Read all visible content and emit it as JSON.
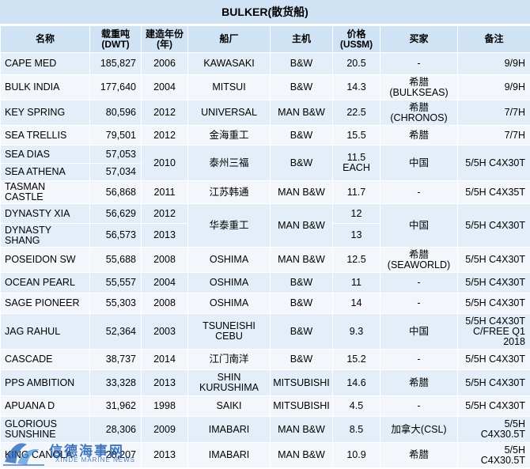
{
  "title": "BULKER(散货船)",
  "headers": {
    "name": "名称",
    "dwt_line1": "载重吨",
    "dwt_line2": "(DWT)",
    "year_line1": "建造年份",
    "year_line2": "(年)",
    "yard": "船厂",
    "engine": "主机",
    "price_line1": "价格",
    "price_line2": "(US$M)",
    "buyer": "买家",
    "note": "备注"
  },
  "rows": {
    "r0": {
      "name": "CAPE MED",
      "dwt": "185,827",
      "year": "2006",
      "yard": "KAWASAKI",
      "engine": "B&W",
      "price": "20.5",
      "buyer": "-",
      "note": "9/9H"
    },
    "r1": {
      "name": "BULK INDIA",
      "dwt": "177,640",
      "year": "2004",
      "yard": "MITSUI",
      "engine": "B&W",
      "price": "14.3",
      "buyer_line1": "希腊",
      "buyer_line2": "(BULKSEAS)",
      "note": "9/9H"
    },
    "r2": {
      "name": "KEY SPRING",
      "dwt": "80,596",
      "year": "2012",
      "yard": "UNIVERSAL",
      "engine": "MAN B&W",
      "price": "22.5",
      "buyer_line1": "希腊",
      "buyer_line2": "(CHRONOS)",
      "note": "7/7H"
    },
    "r3": {
      "name": "SEA TRELLIS",
      "dwt": "79,501",
      "year": "2012",
      "yard": "金海重工",
      "engine": "B&W",
      "price": "15.5",
      "buyer": "希腊",
      "note": "7/7H"
    },
    "r4": {
      "name": "SEA DIAS",
      "dwt": "57,053",
      "year": "2010",
      "yard": "泰州三福",
      "engine": "B&W",
      "price_line1": "11.5",
      "price_line2": "EACH",
      "buyer": "中国",
      "note": "5/5H C4X30T"
    },
    "r5": {
      "name": "SEA ATHENA",
      "dwt": "57,034"
    },
    "r6": {
      "name_line1": "TASMAN",
      "name_line2": "CASTLE",
      "dwt": "56,868",
      "year": "2011",
      "yard": "江苏韩通",
      "engine": "MAN B&W",
      "price": "11.7",
      "buyer": "-",
      "note": "5/5H C4X35T"
    },
    "r7": {
      "name": "DYNASTY XIA",
      "dwt": "56,629",
      "year": "2012",
      "yard": "华泰重工",
      "engine": "MAN B&W",
      "price": "12",
      "buyer": "中国",
      "note": "5/5H C4X30T"
    },
    "r8": {
      "name_line1": "DYNASTY",
      "name_line2": "SHANG",
      "dwt": "56,573",
      "year": "2013",
      "price": "13"
    },
    "r9": {
      "name": "POSEIDON SW",
      "dwt": "55,688",
      "year": "2008",
      "yard": "OSHIMA",
      "engine": "MAN B&W",
      "price": "12.5",
      "buyer_line1": "希腊",
      "buyer_line2": "(SEAWORLD)",
      "note": "5/5H C4X30T"
    },
    "r10": {
      "name": "OCEAN PEARL",
      "dwt": "55,557",
      "year": "2004",
      "yard": "OSHIMA",
      "engine": "B&W",
      "price": "11",
      "buyer": "-",
      "note": "5/5H C4X30T"
    },
    "r11": {
      "name": "SAGE PIONEER",
      "dwt": "55,303",
      "year": "2008",
      "yard": "OSHIMA",
      "engine": "B&W",
      "price": "14",
      "buyer": "-",
      "note": "5/5H C4X30T"
    },
    "r12": {
      "name": "JAG RAHUL",
      "dwt": "52,364",
      "year": "2003",
      "yard_line1": "TSUNEISHI",
      "yard_line2": "CEBU",
      "engine": "B&W",
      "price": "9.3",
      "buyer": "中国",
      "note_line1": "5/5H C4X30T",
      "note_line2": "C/FREE Q1",
      "note_line3": "2018"
    },
    "r13": {
      "name": "CASCADE",
      "dwt": "38,737",
      "year": "2014",
      "yard": "江门南洋",
      "engine": "B&W",
      "price": "15.2",
      "buyer": "-",
      "note": "5/5H C4X30T"
    },
    "r14": {
      "name": "PPS AMBITION",
      "dwt": "33,328",
      "year": "2013",
      "yard_line1": "SHIN",
      "yard_line2": "KURUSHIMA",
      "engine": "MITSUBISHI",
      "price": "14.6",
      "buyer": "希腊",
      "note": "5/5H C4X30T"
    },
    "r15": {
      "name": "APUANA D",
      "dwt": "31,962",
      "year": "1998",
      "yard": "SAIKI",
      "engine": "MITSUBISHI",
      "price": "4.5",
      "buyer": "-",
      "note": "5/5H C4X30T"
    },
    "r16": {
      "name_line1": "GLORIOUS",
      "name_line2": "SUNSHINE",
      "dwt": "28,306",
      "year": "2009",
      "yard": "IMABARI",
      "engine": "MAN B&W",
      "price": "8.5",
      "buyer": "加拿大(CSL)",
      "note_line1": "5/5H",
      "note_line2": "C4X30.5T"
    },
    "r17": {
      "name": "KING CANOLA",
      "dwt": "28,207",
      "year": "2013",
      "yard": "IMABARI",
      "engine": "MAN B&W",
      "price": "10.9",
      "buyer": "希腊",
      "note_line1": "5/5H",
      "note_line2": "C4X30.5T"
    }
  },
  "watermark": {
    "text": "信德海事网",
    "sub": "XINDE MARINE NEWS"
  },
  "colors": {
    "header_bg": "#cfe3f5",
    "row_odd": "#e3eef9",
    "row_even": "#f3f7fc",
    "watermark": "#1e5fb3"
  }
}
